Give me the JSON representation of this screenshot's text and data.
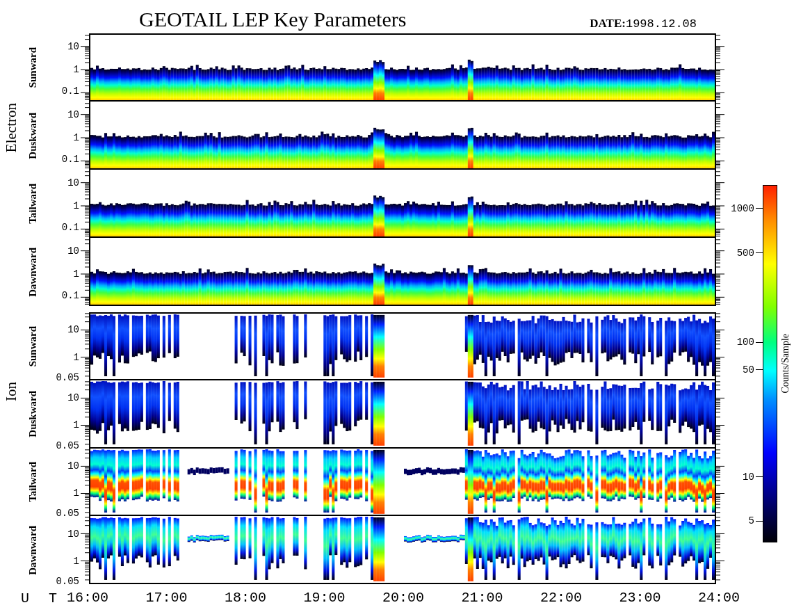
{
  "title": "GEOTAIL LEP Key Parameters",
  "date": {
    "label": "DATE:",
    "value": "1998.12.08"
  },
  "groups": [
    {
      "label": "Electron",
      "panels": [
        {
          "label": "Sunward",
          "kind": "electron",
          "yticks": [
            "10",
            "1",
            "0.1"
          ]
        },
        {
          "label": "Duskward",
          "kind": "electron",
          "yticks": [
            "10",
            "1",
            "0.1"
          ]
        },
        {
          "label": "Tailward",
          "kind": "electron",
          "yticks": [
            "10",
            "1",
            "0.1"
          ]
        },
        {
          "label": "Dawnward",
          "kind": "electron",
          "yticks": [
            "10",
            "1",
            "0.1"
          ]
        }
      ]
    },
    {
      "label": "Ion",
      "panels": [
        {
          "label": "Sunward",
          "kind": "sparse",
          "yticks": [
            "10",
            "1",
            "0.05"
          ]
        },
        {
          "label": "Duskward",
          "kind": "sparse",
          "yticks": [
            "10",
            "1",
            "0.05"
          ]
        },
        {
          "label": "Tailward",
          "kind": "band",
          "yticks": [
            "10",
            "1",
            "0.05"
          ]
        },
        {
          "label": "Dawnward",
          "kind": "broad",
          "yticks": [
            "10",
            "1",
            "0.05"
          ]
        }
      ]
    }
  ],
  "time_axis": {
    "label": "U T",
    "ticks": [
      "16:00",
      "17:00",
      "18:00",
      "19:00",
      "20:00",
      "21:00",
      "22:00",
      "23:00",
      "24:00"
    ]
  },
  "colorbar": {
    "label": "Counts/Sample",
    "ticks": [
      "1000",
      "500",
      "100",
      "50",
      "10",
      "5"
    ]
  }
}
